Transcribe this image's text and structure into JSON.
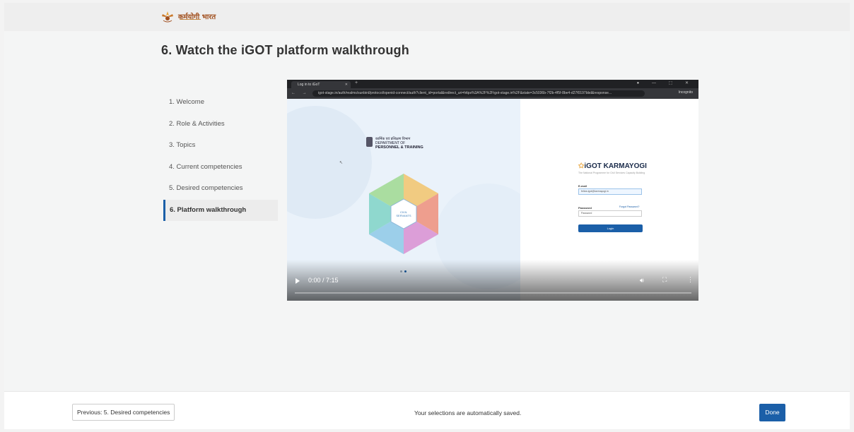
{
  "header": {
    "logo_text": "कर्मयोगी भारत",
    "logo_icon": "karmayogi-logo"
  },
  "page": {
    "title": "6. Watch the iGOT platform walkthrough"
  },
  "steps": [
    {
      "label": "1. Welcome",
      "active": false
    },
    {
      "label": "2. Role & Activities",
      "active": false
    },
    {
      "label": "3. Topics",
      "active": false
    },
    {
      "label": "4. Current competencies",
      "active": false
    },
    {
      "label": "5. Desired competencies",
      "active": false
    },
    {
      "label": "6. Platform walkthrough",
      "active": true
    }
  ],
  "video": {
    "tab_title": "Log in to iGoT",
    "url": "igot-stage.in/auth/realms/sunbird/protocol/openid-connect/auth?client_id=portal&redirect_uri=https%3A%2F%2Figot-stage.in%2F&state=3c5036b-7f2b-4f5f-8be4-d27f0197bbd&response...",
    "incognito_label": "Incognito",
    "dept_line1": "कार्मिक एवं प्रशिक्षण विभाग",
    "dept_line2": "DEPARTMENT OF",
    "dept_line3": "PERSONNEL & TRAINING",
    "hex_center": "CIVIL SERVANTS",
    "igot_brand": "iGOT KARMAYOGI",
    "igot_tagline": "The National Programme for Civil Services Capacity Building",
    "email_label": "E-mail",
    "email_value": "fellow.igot@karmayogi.in",
    "password_label": "Password",
    "password_placeholder": "Password",
    "forgot_label": "Forgot Password?",
    "login_label": "Login",
    "time": "0:00 / 7:15",
    "progress": 0
  },
  "footer": {
    "prev_label": "Previous: 5. Desired competencies",
    "saved_text": "Your selections are automatically saved.",
    "done_label": "Done"
  },
  "colors": {
    "accent": "#1b5fa8",
    "background": "#f4f5f5"
  }
}
